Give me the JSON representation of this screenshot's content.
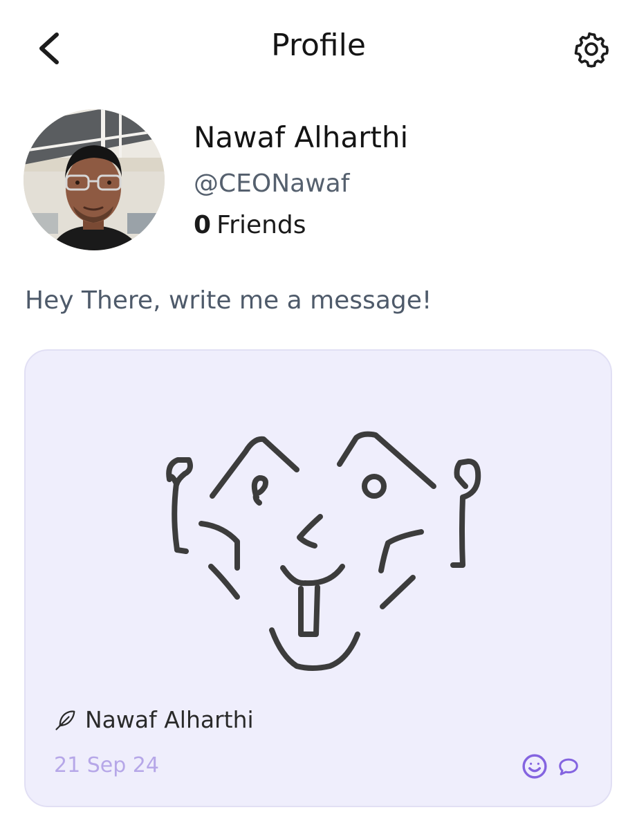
{
  "header": {
    "title": "Profile",
    "back_icon": "chevron-left-icon",
    "settings_icon": "gear-icon"
  },
  "profile": {
    "name": "Nawaf Alharthi",
    "handle": "@CEONawaf",
    "friends_count": "0",
    "friends_label": "Friends",
    "bio": "Hey There, write me a message!"
  },
  "post": {
    "author_icon": "feather-icon",
    "author": "Nawaf Alharthi",
    "date": "21 Sep 24",
    "react_icon": "smiley-icon",
    "comment_icon": "speech-bubble-icon"
  },
  "colors": {
    "card_background": "#efeefc",
    "card_border": "#e1dff4",
    "accent": "#8464e0",
    "date_text": "#b6a7e8",
    "secondary_text": "#55606e",
    "drawing_ink": "#3c3c3c"
  }
}
